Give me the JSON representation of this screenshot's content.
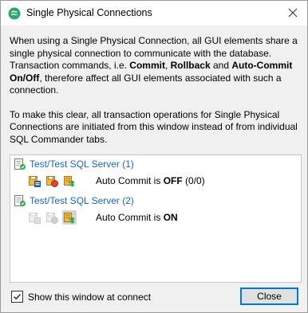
{
  "window": {
    "title": "Single Physical Connections"
  },
  "description": {
    "p1_pre": "When using a Single Physical Connection, all GUI elements share a single physical connection to communicate with the database. Transaction commands, i.e. ",
    "commit": "Commit",
    "sep1": ", ",
    "rollback": "Rollback",
    "and": " and ",
    "autocommit": "Auto-Commit On/Off",
    "p1_post": ", therefore affect all GUI elements associated with such a connection.",
    "p2": "To make this clear, all transaction operations for Single Physical Connections are initiated from this window instead of from individual SQL Commander tabs."
  },
  "connections": [
    {
      "name": "Test/Test SQL Server (1)",
      "status_prefix": "Auto Commit is ",
      "status_value": "OFF",
      "status_suffix": " (0/0)"
    },
    {
      "name": "Test/Test SQL Server (2)",
      "status_prefix": "Auto Commit is ",
      "status_value": "ON",
      "status_suffix": ""
    }
  ],
  "footer": {
    "checkbox_label": "Show this window at connect",
    "checkbox_checked": true,
    "close_label": "Close"
  },
  "colors": {
    "link": "#1a64c8",
    "accent": "#0078d7",
    "app_icon": "#2ea86b"
  }
}
